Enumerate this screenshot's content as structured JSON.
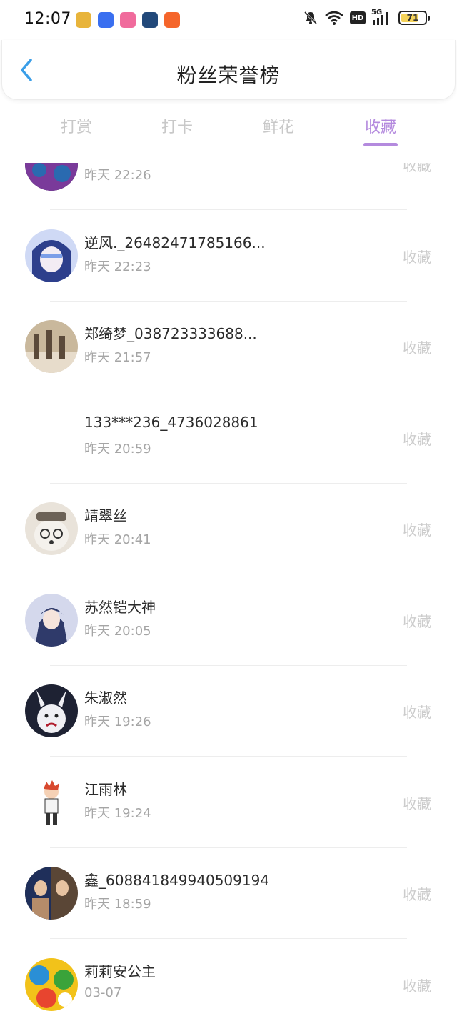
{
  "status_bar": {
    "time": "12:07",
    "network": "5G",
    "hd_label": "HD",
    "battery_level": "71",
    "battery_color": "#f5d35a",
    "app_icons": [
      {
        "name": "game-app-icon",
        "color": "#e8b43b"
      },
      {
        "name": "baidu-app-icon",
        "color": "#3a6ff0"
      },
      {
        "name": "bilibili-app-icon",
        "color": "#f06b9c"
      },
      {
        "name": "camera-app-icon",
        "color": "#22497a"
      },
      {
        "name": "kuaishou-app-icon",
        "color": "#f5652a"
      }
    ]
  },
  "header": {
    "title": "粉丝荣誉榜",
    "back_icon": "chevron-left-icon",
    "back_color": "#3a9ee8"
  },
  "tabs": [
    {
      "label": "打赏",
      "active": false
    },
    {
      "label": "打卡",
      "active": false
    },
    {
      "label": "鲜花",
      "active": false
    },
    {
      "label": "收藏",
      "active": true
    }
  ],
  "accent_color": "#b48ade",
  "list": [
    {
      "name": "",
      "time": "昨天 22:26",
      "action": "收藏",
      "avatar": "dark-crowd-avatar",
      "avatar_colors": [
        "#1a1b3a",
        "#7a3a9a",
        "#2a6ab0"
      ]
    },
    {
      "name": "逆风._26482471785166...",
      "time": "昨天 22:23",
      "action": "收藏",
      "avatar": "anime-boy-avatar",
      "avatar_colors": [
        "#cfd9f5",
        "#2d3f8c",
        "#7c9ee8"
      ]
    },
    {
      "name": "郑绮梦_038723333688...",
      "time": "昨天 21:57",
      "action": "收藏",
      "avatar": "group-photo-avatar",
      "avatar_colors": [
        "#c9b89c",
        "#5b4a3a",
        "#e7dccb"
      ]
    },
    {
      "name": "133***236_4736028861",
      "time": "昨天 20:59",
      "action": "收藏",
      "avatar": "",
      "avatar_colors": [
        "#ffffff",
        "#ffffff",
        "#ffffff"
      ]
    },
    {
      "name": "靖翠丝",
      "time": "昨天 20:41",
      "action": "收藏",
      "avatar": "dog-with-glasses-avatar",
      "avatar_colors": [
        "#e9e3da",
        "#6c6257",
        "#b9ad9f"
      ]
    },
    {
      "name": "苏然铠大神",
      "time": "昨天 20:05",
      "action": "收藏",
      "avatar": "anime-character-avatar",
      "avatar_colors": [
        "#d4d8ec",
        "#2f3a6a",
        "#8fa2d6"
      ]
    },
    {
      "name": "朱淑然",
      "time": "昨天 19:26",
      "action": "收藏",
      "avatar": "cartoon-rabbit-avatar",
      "avatar_colors": [
        "#1e2233",
        "#f0f0f4",
        "#b01d2d"
      ]
    },
    {
      "name": "江雨林",
      "time": "昨天 19:24",
      "action": "收藏",
      "avatar": "chibi-character-avatar",
      "avatar_colors": [
        "#ffffff",
        "#d8492f",
        "#333333"
      ]
    },
    {
      "name": "鑫_608841849940509194",
      "time": "昨天 18:59",
      "action": "收藏",
      "avatar": "movie-heroes-avatar",
      "avatar_colors": [
        "#5a4636",
        "#1f2f5a",
        "#b58c6a"
      ]
    },
    {
      "name": "莉莉安公主",
      "time": "03-07",
      "action": "收藏",
      "avatar": "colorful-cartoon-avatar",
      "avatar_colors": [
        "#f2c21a",
        "#2a8fd6",
        "#3aa33a"
      ]
    }
  ]
}
